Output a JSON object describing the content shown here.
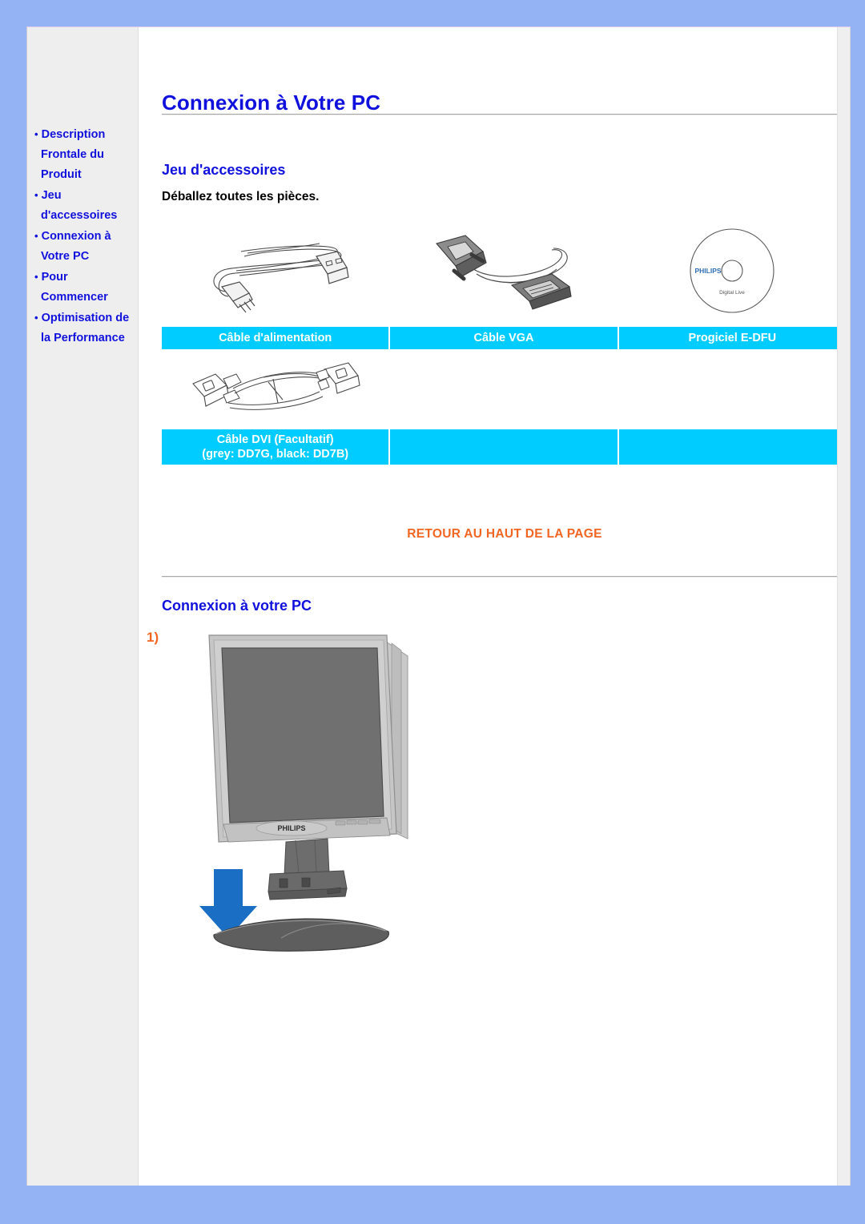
{
  "page": {
    "title": "Connexion à Votre PC",
    "background_color": "#93b3f5",
    "accent_blue": "#1111dd",
    "accent_cyan": "#00ccff",
    "accent_orange": "#f26522"
  },
  "sidebar": {
    "items": [
      {
        "bullet": "•",
        "label": "Description Frontale du Produit"
      },
      {
        "bullet": "•",
        "label": "Jeu d'accessoires"
      },
      {
        "bullet": "•",
        "label": "Connexion à Votre PC"
      },
      {
        "bullet": "•",
        "label": "Pour Commencer"
      },
      {
        "bullet": "•",
        "label": "Optimisation de la Performance"
      }
    ]
  },
  "main": {
    "heading_accessories": "Jeu d'accessoires",
    "unpack_text": "Déballez toutes les pièces.",
    "retour_link": "RETOUR AU HAUT DE LA PAGE",
    "heading_connexion": "Connexion à votre PC",
    "step_label": "1)"
  },
  "accessories_table": {
    "rows": [
      {
        "images": [
          "power-cable-image",
          "vga-cable-image",
          "edfu-cd-image"
        ],
        "labels": [
          "Câble d'alimentation",
          "Câble VGA",
          "Progiciel E-DFU"
        ]
      },
      {
        "images": [
          "dvi-cable-image",
          "",
          ""
        ],
        "labels": [
          "Câble DVI (Facultatif)\n(grey: DD7G, black: DD7B)",
          "",
          ""
        ]
      }
    ],
    "dvi_label_line1": "Câble DVI (Facultatif)",
    "dvi_label_line2": "(grey: DD7G, black: DD7B)"
  },
  "illustration": {
    "monitor_brand": "PHILIPS",
    "cd_brand": "PHILIPS",
    "cd_subtitle": "Digital Live",
    "arrow_color": "#1a6fc4",
    "screen_color": "#707070",
    "bezel_color": "#b4b4b4"
  }
}
